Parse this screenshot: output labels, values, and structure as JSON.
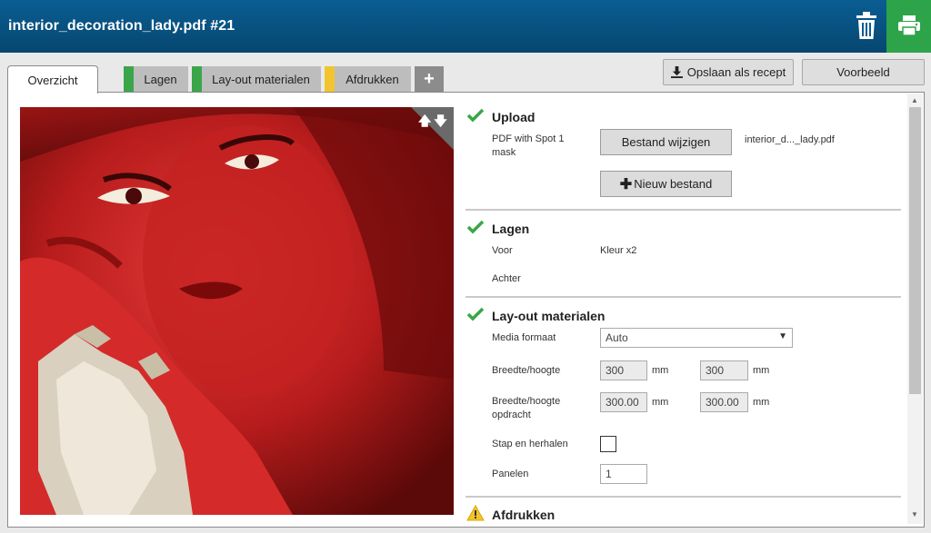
{
  "header": {
    "title": "interior_decoration_lady.pdf #21",
    "accent": "#06476f",
    "print_color": "#2da34a"
  },
  "tabs": [
    {
      "label": "Overzicht",
      "active": true
    },
    {
      "label": "Lagen",
      "status_color": "#3aa649"
    },
    {
      "label": "Lay-out materialen",
      "status_color": "#3aa649"
    },
    {
      "label": "Afdrukken",
      "status_color": "#f2c530"
    },
    {
      "label": "+"
    }
  ],
  "actions": {
    "save_recipe": "Opslaan als recept",
    "preview": "Voorbeeld"
  },
  "upload": {
    "title": "Upload",
    "file_type": "PDF with Spot 1 mask",
    "change_file": "Bestand wijzigen",
    "new_file": "Nieuw bestand",
    "file_name": "interior_d..._lady.pdf"
  },
  "layers": {
    "title": "Lagen",
    "front_label": "Voor",
    "front_value": "Kleur x2",
    "back_label": "Achter"
  },
  "layout": {
    "title": "Lay-out materialen",
    "media_label": "Media formaat",
    "media_value": "Auto",
    "size_label": "Breedte/hoogte",
    "width": "300",
    "height": "300",
    "unit": "mm",
    "job_size_label": "Breedte/hoogte opdracht",
    "job_width": "300.00",
    "job_height": "300.00",
    "step_repeat_label": "Stap en herhalen",
    "panels_label": "Panelen",
    "panels_value": "1"
  },
  "print": {
    "title": "Afdrukken",
    "status_color": "#f2c530"
  }
}
